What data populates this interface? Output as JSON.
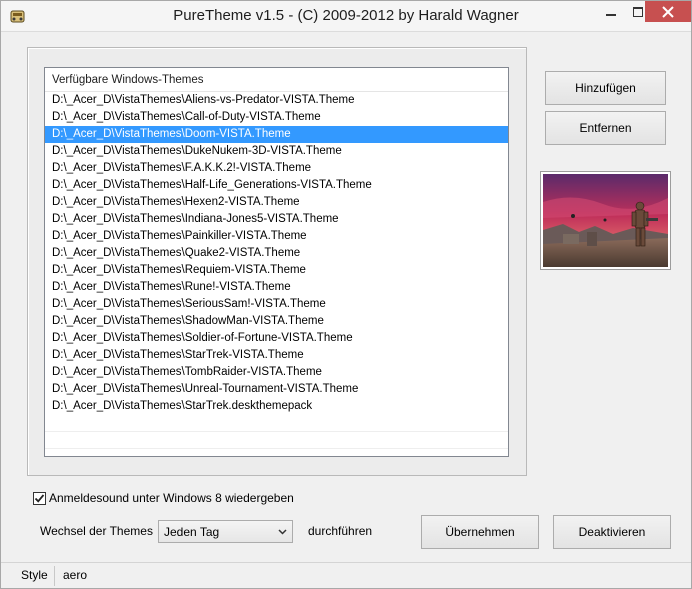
{
  "window": {
    "title": "PureTheme v1.5 - (C) 2009-2012 by Harald Wagner",
    "close_color": "#c75050"
  },
  "themes_list": {
    "header": "Verfügbare Windows-Themes",
    "selected_index": 2,
    "selection_color": "#3399ff",
    "items": [
      "D:\\_Acer_D\\VistaThemes\\Aliens-vs-Predator-VISTA.Theme",
      "D:\\_Acer_D\\VistaThemes\\Call-of-Duty-VISTA.Theme",
      "D:\\_Acer_D\\VistaThemes\\Doom-VISTA.Theme",
      "D:\\_Acer_D\\VistaThemes\\DukeNukem-3D-VISTA.Theme",
      "D:\\_Acer_D\\VistaThemes\\F.A.K.K.2!-VISTA.Theme",
      "D:\\_Acer_D\\VistaThemes\\Half-Life_Generations-VISTA.Theme",
      "D:\\_Acer_D\\VistaThemes\\Hexen2-VISTA.Theme",
      "D:\\_Acer_D\\VistaThemes\\Indiana-Jones5-VISTA.Theme",
      "D:\\_Acer_D\\VistaThemes\\Painkiller-VISTA.Theme",
      "D:\\_Acer_D\\VistaThemes\\Quake2-VISTA.Theme",
      "D:\\_Acer_D\\VistaThemes\\Requiem-VISTA.Theme",
      "D:\\_Acer_D\\VistaThemes\\Rune!-VISTA.Theme",
      "D:\\_Acer_D\\VistaThemes\\SeriousSam!-VISTA.Theme",
      "D:\\_Acer_D\\VistaThemes\\ShadowMan-VISTA.Theme",
      "D:\\_Acer_D\\VistaThemes\\Soldier-of-Fortune-VISTA.Theme",
      "D:\\_Acer_D\\VistaThemes\\StarTrek-VISTA.Theme",
      "D:\\_Acer_D\\VistaThemes\\TombRaider-VISTA.Theme",
      "D:\\_Acer_D\\VistaThemes\\Unreal-Tournament-VISTA.Theme",
      "D:\\_Acer_D\\VistaThemes\\StarTrek.deskthemepack"
    ]
  },
  "buttons": {
    "add": "Hinzufügen",
    "remove": "Entfernen",
    "apply": "Übernehmen",
    "deactivate": "Deaktivieren"
  },
  "options": {
    "login_sound_label": "Anmeldesound unter Windows 8 wiedergeben",
    "login_sound_checked": true,
    "change_label": "Wechsel der Themes",
    "change_value": "Jeden Tag",
    "change_suffix": "durchführen"
  },
  "statusbar": {
    "style_label": "Style",
    "style_value": "aero"
  }
}
